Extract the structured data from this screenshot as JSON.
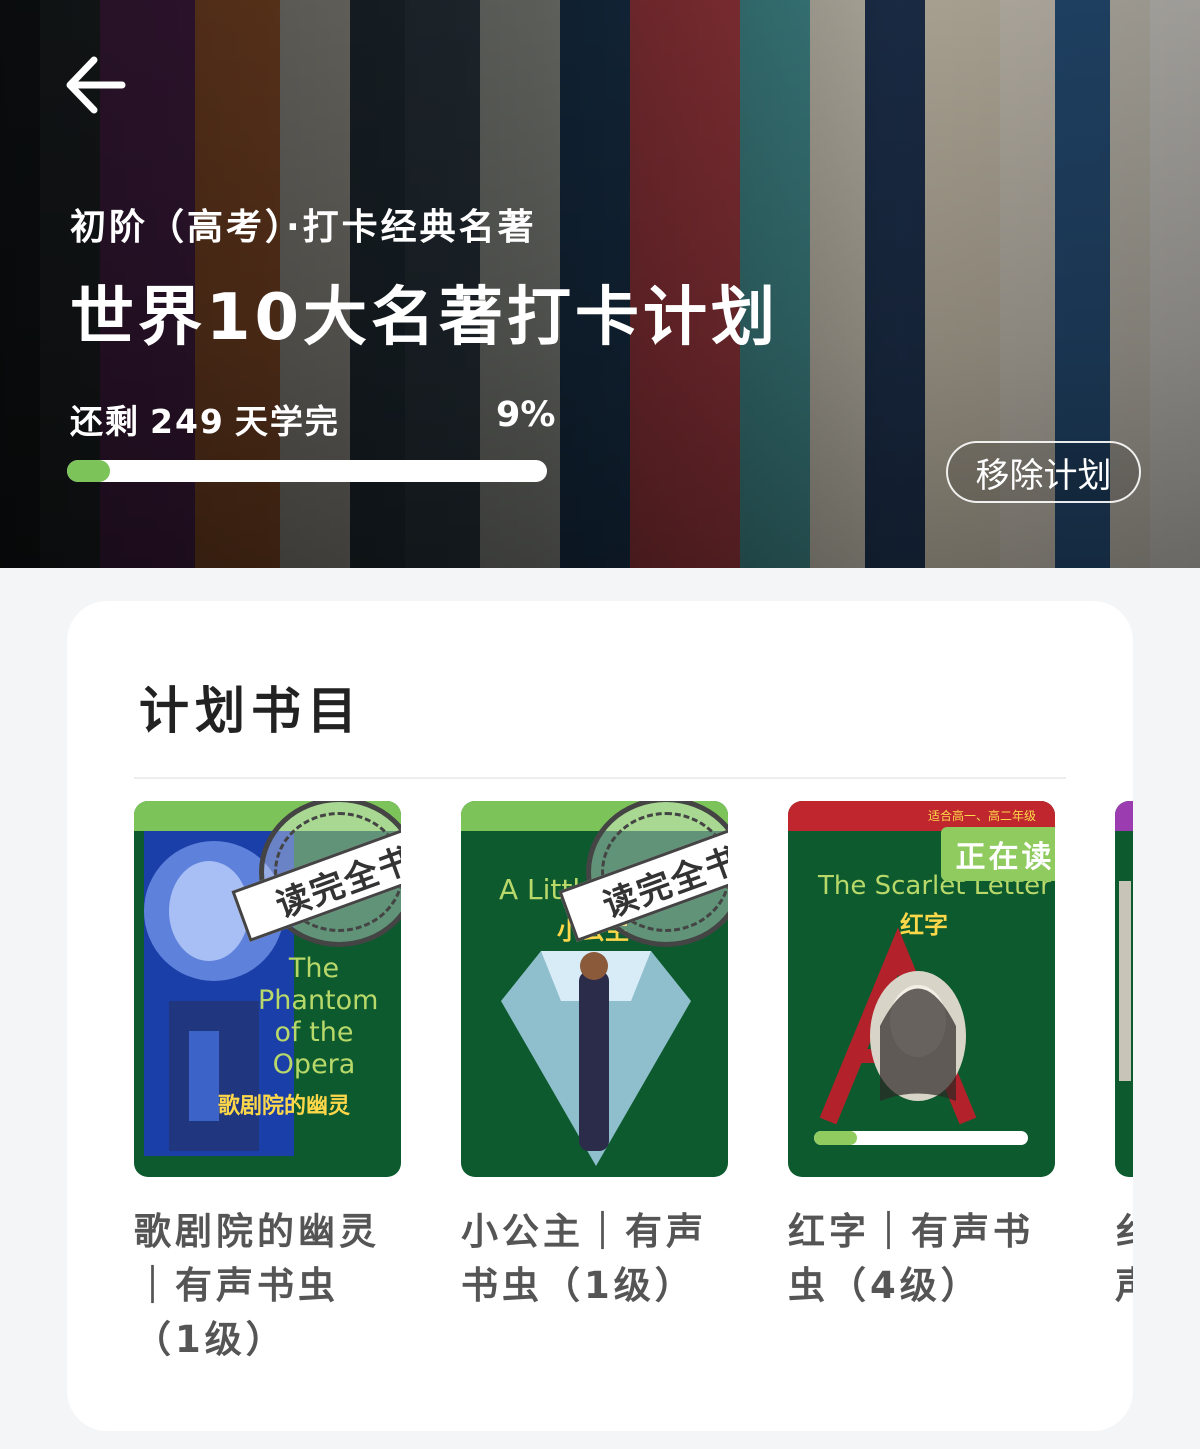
{
  "header": {
    "back_icon": "arrow-left-icon",
    "subtitle": "初阶（高考）·打卡经典名著",
    "title": "世界10大名著打卡计划",
    "remaining_prefix": "还剩",
    "remaining_days": "249",
    "remaining_suffix": "天学完",
    "percent_label": "9%",
    "progress": 0.09,
    "remove_button": "移除计划",
    "accent_color": "#7cc35a"
  },
  "plan": {
    "section_title": "计划书目",
    "books": [
      {
        "title": "歌剧院的幽灵｜有声书虫（1级）",
        "cover_en": [
          "The",
          "Phantom",
          "of the",
          "Opera"
        ],
        "cover_cn": "歌剧院的幽灵",
        "stamp": "读完全书",
        "top_color": "#7cc35a"
      },
      {
        "title": "小公主｜有声书虫（1级）",
        "cover_en": "A Little",
        "cover_cn": "小公主",
        "stamp": "读完全书",
        "top_color": "#7cc35a"
      },
      {
        "title": "红字｜有声书虫（4级）",
        "cover_en": "The Scarlet Letter",
        "cover_cn": "红字",
        "cover_note": "适合高一、高二年级",
        "badge": "正在读",
        "progress": 0.2,
        "top_color": "#c0262d"
      },
      {
        "title": "纟\n声",
        "top_color": "#9b3db0"
      }
    ]
  }
}
